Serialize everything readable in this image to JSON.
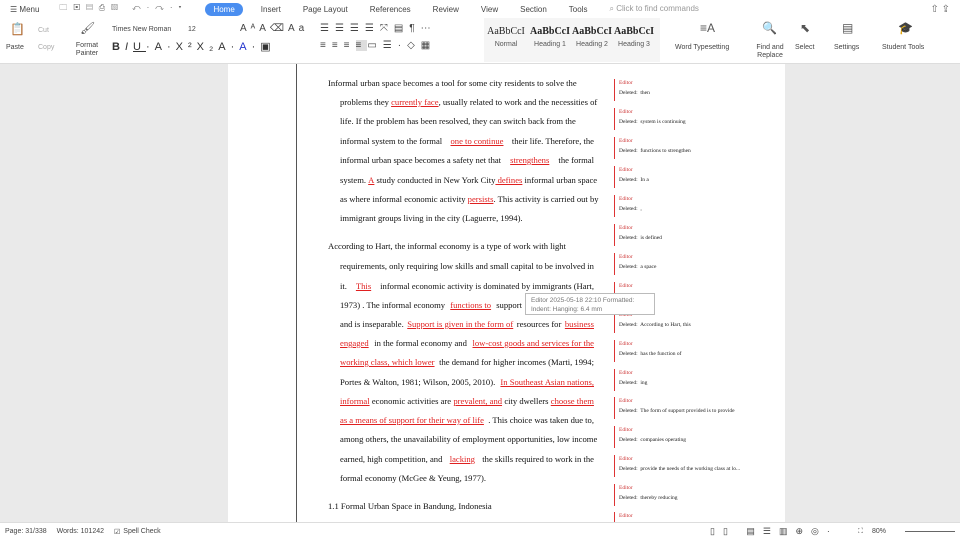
{
  "menubar": {
    "menu": "Menu",
    "tabs": [
      "Home",
      "Insert",
      "Page Layout",
      "References",
      "Review",
      "View",
      "Section",
      "Tools"
    ],
    "search": "Click to find commands"
  },
  "ribbon": {
    "paste": "Paste",
    "cut": "Cut",
    "copy": "Copy",
    "format_painter": "Format Painter",
    "font": "Times New Roman",
    "size": "12",
    "styles": [
      {
        "preview": "AaBbCcI",
        "label": "Normal"
      },
      {
        "preview": "AaBbCcI",
        "label": "Heading 1"
      },
      {
        "preview": "AaBbCcI",
        "label": "Heading 2"
      },
      {
        "preview": "AaBbCcI",
        "label": "Heading 3"
      }
    ],
    "word_typesetting": "Word Typesetting",
    "find_replace": "Find and Replace",
    "select": "Select",
    "settings": "Settings",
    "student_tools": "Student Tools"
  },
  "doc": {
    "lines": [
      [
        {
          "t": "Informal urban space becomes a tool for some city residents to solve the"
        }
      ],
      [
        {
          "t": "problems they "
        },
        {
          "t": "currently face",
          "ins": 1
        },
        {
          "t": ", usually related to work and the necessities of"
        }
      ],
      [
        {
          "t": "life. If the problem has been resolved, they can switch back from the"
        }
      ],
      [
        {
          "t": "informal system to the formal "
        },
        {
          "t": "one to continue",
          "ins": 1
        },
        {
          "t": " their life. Therefore, the"
        }
      ],
      [
        {
          "t": "informal urban space becomes a safety net that "
        },
        {
          "t": "strengthens",
          "ins": 1
        },
        {
          "t": " the formal"
        }
      ],
      [
        {
          "t": "system. "
        },
        {
          "t": "A",
          "ins": 1
        },
        {
          "t": " study conducted in New York City"
        },
        {
          "t": " defines",
          "ins": 1
        },
        {
          "t": " informal urban space"
        }
      ],
      [
        {
          "t": "as where informal economic activity "
        },
        {
          "t": "persists",
          "ins": 1
        },
        {
          "t": ". This activity is carried out by"
        }
      ],
      [
        {
          "t": "immigrant groups living in the city (Laguerre, 1994)."
        }
      ],
      [
        {
          "t": "According to Hart, the informal economy is a type of work with light"
        }
      ],
      [
        {
          "t": "requirements, only requiring low skills and small capital to be involved in"
        }
      ],
      [
        {
          "t": "it. "
        },
        {
          "t": "This",
          "ins": 1
        },
        {
          "t": " informal economic activity is dominated by immigrants (Hart,"
        }
      ],
      [
        {
          "t": "1973) . The informal economy "
        },
        {
          "t": "functions to",
          "ins": 1
        },
        {
          "t": " support"
        }
      ],
      [
        {
          "t": "and is inseparable. "
        },
        {
          "t": "Support is given in the form of",
          "ins": 1
        },
        {
          "t": " resources for "
        },
        {
          "t": "business",
          "ins": 1
        }
      ],
      [
        {
          "t": "engaged",
          "ins": 1
        },
        {
          "t": " in the formal economy and "
        },
        {
          "t": "low-cost goods and services for the",
          "ins": 1
        }
      ],
      [
        {
          "t": "working class, which lower",
          "ins": 1
        },
        {
          "t": " the demand for higher incomes (Marti, 1994;"
        }
      ],
      [
        {
          "t": "Portes & Walton, 1981; Wilson, 2005, 2010). "
        },
        {
          "t": "In Southeast Asian nations,",
          "ins": 1
        }
      ],
      [
        {
          "t": "informal",
          "ins": 1
        },
        {
          "t": " economic activities are "
        },
        {
          "t": "prevalent, and",
          "ins": 1
        },
        {
          "t": " city dwellers "
        },
        {
          "t": "choose them",
          "ins": 1
        }
      ],
      [
        {
          "t": "as a means of support for their way of life",
          "ins": 1
        },
        {
          "t": ". This choice was taken due to,"
        }
      ],
      [
        {
          "t": "among others, the unavailability of employment opportunities, low income"
        }
      ],
      [
        {
          "t": "earned, high competition, and "
        },
        {
          "t": "lacking",
          "ins": 1
        },
        {
          "t": " the skills required to work in the"
        }
      ],
      [
        {
          "t": "formal economy (McGee & Yeung, 1977)."
        }
      ],
      [
        {
          "t": "1.1 Formal Urban Space in Bandung, Indonesia"
        }
      ]
    ]
  },
  "comments": {
    "editor": "Editor",
    "deleted_prefix": "Deleted:",
    "items": [
      "then",
      "system is continuing",
      "functions to strengthen",
      "In a",
      ",",
      "is defined",
      "a space",
      "place",
      "According to Hart, this",
      "has the function of",
      "ing",
      "The form of support provided is to provide",
      "companies operating",
      "provide the needs of the working class at lo...",
      "thereby reducing",
      ""
    ]
  },
  "tooltip": {
    "line1": "Editor 2025-05-18 22:10 Formatted:",
    "line2": "Indent: Hanging: 6.4 mm"
  },
  "status": {
    "page": "Page: 31/338",
    "words": "Words: 101242",
    "spell": "Spell Check",
    "zoom": "80%"
  }
}
